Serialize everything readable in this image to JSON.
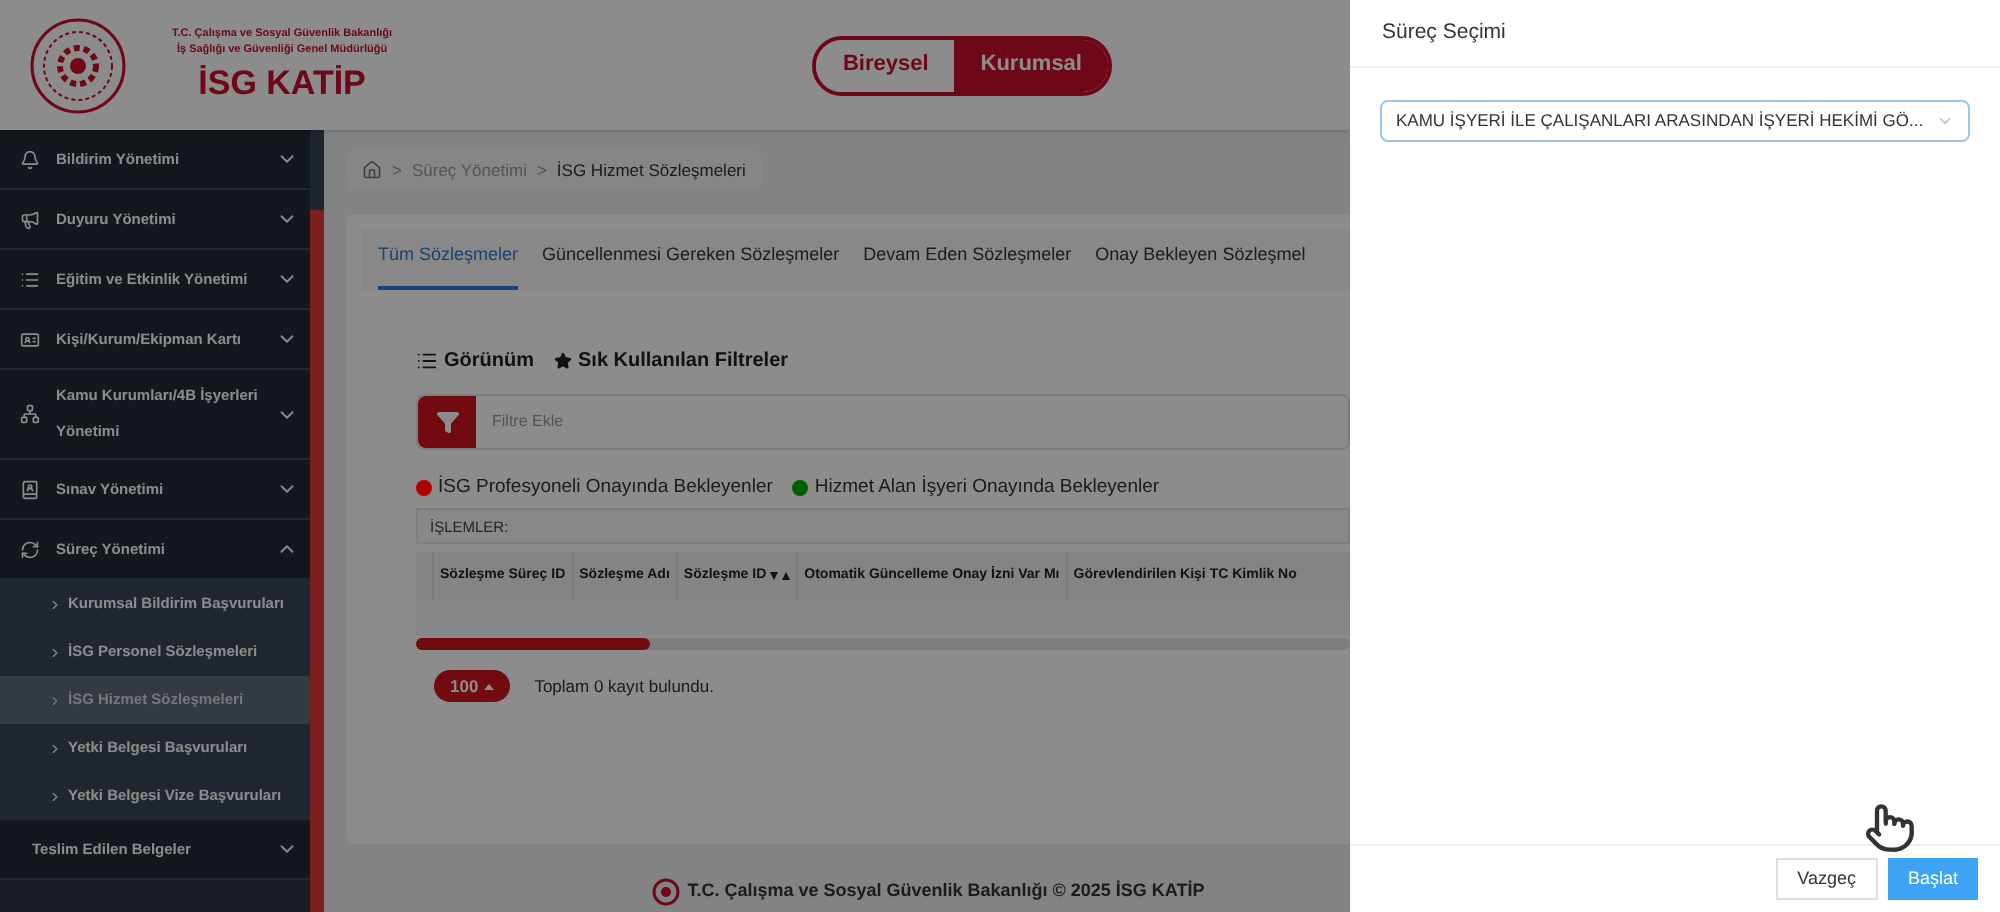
{
  "header": {
    "ministry_lines": [
      "T.C. Çalışma ve Sosyal Güvenlik Bakanlığı",
      "İş Sağlığı ve Güvenliği Genel Müdürlüğü"
    ],
    "brand": "İSG KATİP",
    "toggle": [
      {
        "label": "Bireysel",
        "selected": false
      },
      {
        "label": "Kurumsal",
        "selected": true
      }
    ]
  },
  "sidebar": {
    "items": [
      {
        "label": "Bildirim Yönetimi",
        "expanded": false
      },
      {
        "label": "Duyuru Yönetimi",
        "expanded": false
      },
      {
        "label": "Eğitim ve Etkinlik Yönetimi",
        "expanded": false
      },
      {
        "label": "Kişi/Kurum/Ekipman Kartı",
        "expanded": false
      },
      {
        "label": "Kamu Kurumları/4B İşyerleri Yönetimi",
        "expanded": false
      },
      {
        "label": "Sınav Yönetimi",
        "expanded": false
      },
      {
        "label": "Süreç Yönetimi",
        "expanded": true,
        "children": [
          {
            "label": "Kurumsal Bildirim Başvuruları",
            "selected": false
          },
          {
            "label": "İSG Personel Sözleşmeleri",
            "selected": false
          },
          {
            "label": "İSG Hizmet Sözleşmeleri",
            "selected": true
          },
          {
            "label": "Yetki Belgesi Başvuruları",
            "selected": false
          },
          {
            "label": "Yetki Belgesi Vize Başvuruları",
            "selected": false
          }
        ]
      },
      {
        "label": "Teslim Edilen Belgeler",
        "expanded": false
      }
    ]
  },
  "breadcrumb": {
    "separator": ">",
    "items": [
      "Süreç Yönetimi",
      "İSG Hizmet Sözleşmeleri"
    ]
  },
  "tabs": [
    {
      "label": "Tüm Sözleşmeler",
      "selected": true
    },
    {
      "label": "Güncellenmesi Gereken Sözleşmeler",
      "selected": false
    },
    {
      "label": "Devam Eden Sözleşmeler",
      "selected": false
    },
    {
      "label": "Onay Bekleyen Sözleşmel",
      "selected": false
    }
  ],
  "toolbar": [
    "Görünüm",
    "Sık Kullanılan Filtreler"
  ],
  "filter": {
    "placeholder": "Filtre Ekle"
  },
  "legend": [
    {
      "label": "İSG Profesyoneli Onayında Bekleyenler",
      "color": "#b00000"
    },
    {
      "label": "Hizmet Alan İşyeri Onayında Bekleyenler",
      "color": "#006000"
    }
  ],
  "actions_label": "İŞLEMLER:",
  "table": {
    "columns": [
      {
        "label": "Sözleşme Süreç ID",
        "sortable": false
      },
      {
        "label": "Sözleşme Adı",
        "sortable": false
      },
      {
        "label": "Sözleşme ID",
        "sortable": true
      },
      {
        "label": "Otomatik Güncelleme Onay İzni Var Mı",
        "sortable": false
      },
      {
        "label": "Görevlendirilen Kişi TC Kimlik No",
        "sortable": false
      }
    ]
  },
  "pagination": {
    "page_size": "100",
    "summary": "Toplam 0 kayıt bulundu."
  },
  "footer": "T.C. Çalışma ve Sosyal Güvenlik Bakanlığı © 2025 İSG KATİP",
  "drawer": {
    "title": "Süreç Seçimi",
    "select_value": "KAMU İŞYERİ İLE ÇALIŞANLARI ARASINDAN İŞYERİ HEKİMİ GÖ...",
    "buttons": [
      {
        "label": "Vazgeç",
        "kind": "secondary"
      },
      {
        "label": "Başlat",
        "kind": "primary"
      }
    ]
  }
}
